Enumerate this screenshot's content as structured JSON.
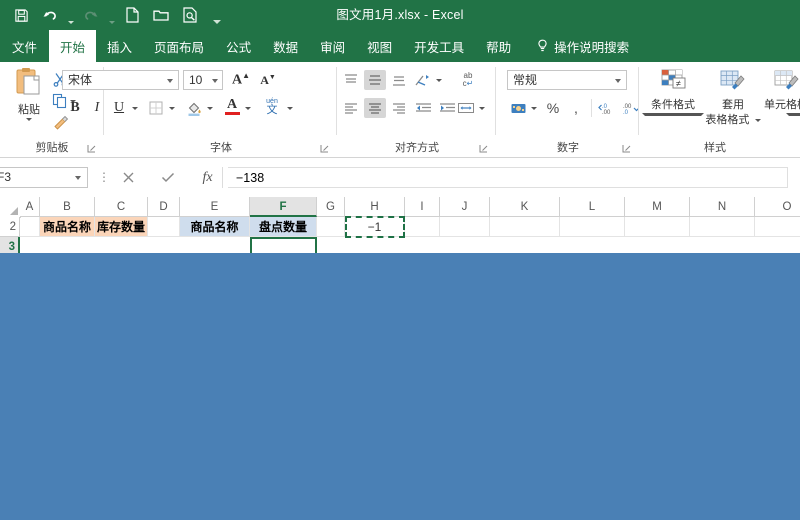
{
  "window": {
    "title": "图文用1月.xlsx  -  Excel"
  },
  "quick_access": {
    "items": [
      {
        "name": "save-icon",
        "label": "保存"
      },
      {
        "name": "undo-icon",
        "label": "撤消"
      },
      {
        "name": "redo-icon",
        "label": "恢复"
      },
      {
        "name": "new-icon",
        "label": "新建"
      },
      {
        "name": "open-icon",
        "label": "打开"
      },
      {
        "name": "print-preview-icon",
        "label": "打印预览和打印"
      },
      {
        "name": "customize-qat-icon",
        "label": "自定义快速访问工具栏"
      }
    ]
  },
  "ribbon": {
    "tabs": [
      {
        "label": "文件",
        "active": false
      },
      {
        "label": "开始",
        "active": true
      },
      {
        "label": "插入",
        "active": false
      },
      {
        "label": "页面布局",
        "active": false
      },
      {
        "label": "公式",
        "active": false
      },
      {
        "label": "数据",
        "active": false
      },
      {
        "label": "审阅",
        "active": false
      },
      {
        "label": "视图",
        "active": false
      },
      {
        "label": "开发工具",
        "active": false
      },
      {
        "label": "帮助",
        "active": false
      }
    ],
    "tell_me": "操作说明搜索",
    "groups": {
      "clipboard": {
        "label": "剪贴板",
        "paste_label": "粘贴",
        "cut_label": "剪切",
        "copy_label": "复制",
        "format_painter_label": "格式刷"
      },
      "font": {
        "label": "字体",
        "font_name": "宋体",
        "font_size": "10",
        "grow_label": "增大字号",
        "shrink_label": "减小字号",
        "bold_label": "B",
        "italic_label": "I",
        "underline_label": "U",
        "border_label": "边框",
        "fill_label": "填充颜色",
        "fontcolor_label": "字体颜色",
        "phonetic_label": "拼音指南"
      },
      "alignment": {
        "label": "对齐方式",
        "top_align": "顶端对齐",
        "middle_align": "垂直居中",
        "bottom_align": "底端对齐",
        "orientation": "方向",
        "align_left": "左对齐",
        "align_center": "居中",
        "align_right": "右对齐",
        "decrease_indent": "减少缩进量",
        "increase_indent": "增加缩进量",
        "wrap_text": "自动换行",
        "merge_center": "合并后居中"
      },
      "number": {
        "label": "数字",
        "format": "常规",
        "accounting": "会计数字格式",
        "percent": "%",
        "comma": "千位分隔样式",
        "increase_decimal": "增加小数位数",
        "decrease_decimal": "减少小数位数"
      },
      "styles": {
        "label": "样式",
        "items": [
          {
            "label": "条件格式",
            "label2": ""
          },
          {
            "label": "套用",
            "label2": "表格格式"
          },
          {
            "label": "单元格样式",
            "label2": ""
          }
        ]
      }
    }
  },
  "formula_bar": {
    "name_box": "F3",
    "cancel_label": "取消",
    "enter_label": "输入",
    "function_label": "fx",
    "formula": "−138"
  },
  "sheet": {
    "columns": [
      "A",
      "B",
      "C",
      "D",
      "E",
      "F",
      "G",
      "H",
      "I",
      "J",
      "K",
      "L",
      "M",
      "N",
      "O"
    ],
    "active_column": "F",
    "rows": [
      "2",
      "3"
    ],
    "active_row": "3",
    "cells": [
      {
        "ref": "B2",
        "col": "B",
        "row": 0,
        "value": "商品名称",
        "style": "hdrA"
      },
      {
        "ref": "C2",
        "col": "C",
        "row": 0,
        "value": "库存数量",
        "style": "hdrA"
      },
      {
        "ref": "E2",
        "col": "E",
        "row": 0,
        "value": "商品名称",
        "style": "hdrB"
      },
      {
        "ref": "F2",
        "col": "F",
        "row": 0,
        "value": "盘点数量",
        "style": "hdrB"
      },
      {
        "ref": "H2",
        "col": "H",
        "row": 0,
        "value": "−1",
        "style": "num"
      }
    ]
  },
  "colors": {
    "excel_green": "#217346",
    "header_orange": "#fbd5b9",
    "header_blue": "#cfdded",
    "overlay_blue": "#4a80b5",
    "marquee_green": "#1e7145"
  }
}
